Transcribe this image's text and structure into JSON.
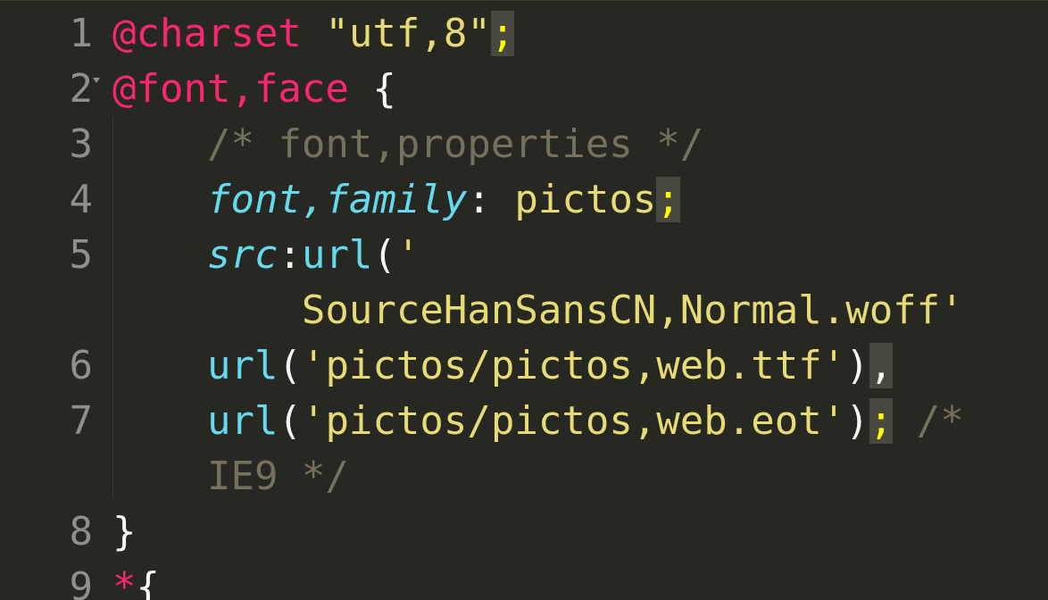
{
  "editor": {
    "theme_colors": {
      "background": "#272822",
      "keyword": "#F92672",
      "string": "#E6DB74",
      "function": "#66D9EF",
      "comment": "#75715E",
      "text": "#F8F8F2"
    },
    "lines": {
      "l1": {
        "num": "1",
        "at_rule": "@charset",
        "space": " ",
        "value": "\"utf,8\"",
        "semi": ";"
      },
      "l2": {
        "num": "2",
        "at_rule": "@font,face",
        "space": " ",
        "brace": "{"
      },
      "l3": {
        "num": "3",
        "indent": "    ",
        "comment": "/* font,properties */"
      },
      "l4": {
        "num": "4",
        "indent": "    ",
        "prop": "font,family",
        "colon": ": ",
        "value": "pictos",
        "semi": ";"
      },
      "l5": {
        "num": "5",
        "indent": "    ",
        "prop": "src",
        "colon": ":",
        "fn": "url",
        "paren": "(",
        "quote": "'"
      },
      "l5b": {
        "indent": "        ",
        "value": "SourceHanSansCN,Normal.woff'"
      },
      "l6": {
        "num": "6",
        "indent": "    ",
        "fn": "url",
        "paren_open": "(",
        "value": "'pictos/pictos,web.ttf'",
        "paren_close": ")",
        "comma": ","
      },
      "l7": {
        "num": "7",
        "indent": "    ",
        "fn": "url",
        "paren_open": "(",
        "value": "'pictos/pictos,web.eot'",
        "paren_close": ")",
        "semi": ";",
        "space": " ",
        "comment": "/*"
      },
      "l7b": {
        "indent": "    ",
        "comment": "IE9 */"
      },
      "l8": {
        "num": "8",
        "brace": "}"
      },
      "l9": {
        "num": "9",
        "selector": "*",
        "brace": "{"
      }
    }
  }
}
